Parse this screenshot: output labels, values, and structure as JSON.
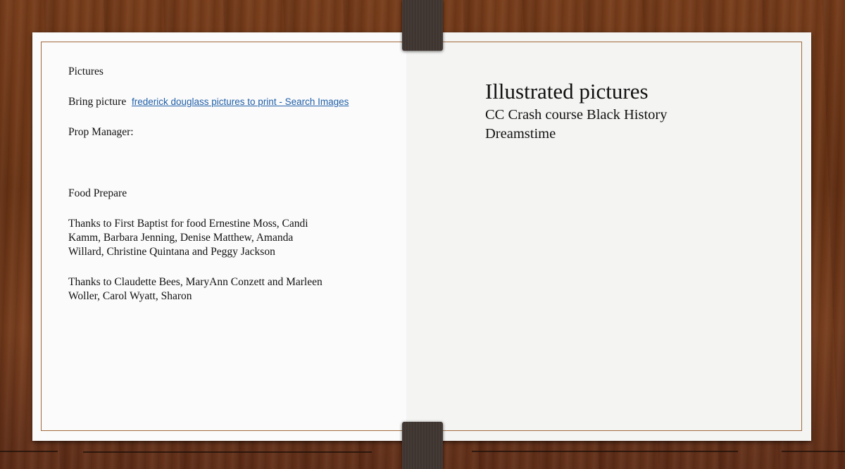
{
  "left_doc": {
    "pictures_heading": "Pictures",
    "bring_picture_label": "Bring picture",
    "bring_picture_link": "frederick douglass pictures to print - Search Images",
    "prop_manager": "Prop Manager:",
    "food_prepare": "Food Prepare",
    "thanks_food": "Thanks to First Baptist for food  Ernestine Moss, Candi Kamm, Barbara  Jenning, Denise Matthew, Amanda Willard, Christine Quintana and Peggy Jackson",
    "thanks_others": "Thanks to Claudette Bees, MaryAnn Conzett and Marleen Woller, Carol Wyatt, Sharon"
  },
  "right_content": {
    "title": "Illustrated pictures",
    "line1": "CC Crash course Black History",
    "line2": "Dreamstime"
  },
  "colors": {
    "wood": "#6b3516",
    "frame_border": "#a06a3e",
    "binder": "#3f3530",
    "link": "#1f5fa8"
  }
}
